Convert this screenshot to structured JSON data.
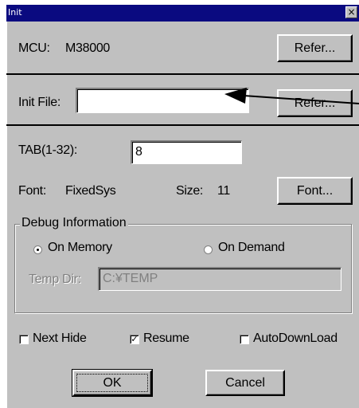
{
  "window": {
    "title": "Init",
    "close_symbol": "×"
  },
  "mcu": {
    "label": "MCU:",
    "value": "M38000",
    "refer_label": "Refer..."
  },
  "init_file": {
    "label": "Init File:",
    "value": "",
    "refer_label": "Refer..."
  },
  "tab": {
    "label": "TAB(1-32):",
    "value": "8"
  },
  "font": {
    "label": "Font:",
    "value": "FixedSys",
    "size_label": "Size:",
    "size_value": "11",
    "button_label": "Font..."
  },
  "debug": {
    "group_title": "Debug Information",
    "on_memory_label": "On Memory",
    "on_demand_label": "On Demand",
    "selected": "On Memory",
    "temp_dir_label": "Temp Dir:",
    "temp_dir_value": "C:¥TEMP"
  },
  "options": {
    "next_hide_label": "Next Hide",
    "next_hide_checked": false,
    "resume_label": "Resume",
    "resume_checked": true,
    "autodownload_label": "AutoDownLoad",
    "autodownload_checked": false
  },
  "buttons": {
    "ok_label": "OK",
    "cancel_label": "Cancel"
  },
  "colors": {
    "titlebar": "#0a0a80",
    "face": "#c0c0c0",
    "annotation": "#000000"
  }
}
